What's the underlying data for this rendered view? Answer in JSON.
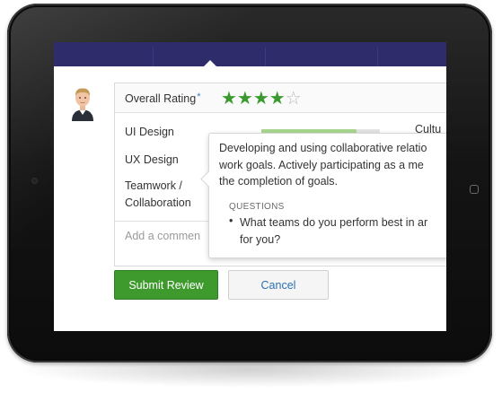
{
  "review": {
    "overall_label": "Overall Rating",
    "required_mark": "*",
    "rating_filled": "★★★★",
    "rating_empty": "☆",
    "rating_value": 4,
    "rating_max": 5
  },
  "skills": [
    {
      "name": "UI Design"
    },
    {
      "name": "UX Design"
    },
    {
      "name": "Teamwork /"
    },
    {
      "name": "Collaboration"
    }
  ],
  "culture_label": "Cultu",
  "comment_placeholder": "Add a commen",
  "tooltip": {
    "description_lines": [
      "Developing and using collaborative relatio",
      "work goals. Actively participating as a me",
      "the completion of goals."
    ],
    "questions_heading": "QUESTIONS",
    "bullet": "•",
    "question_lines": [
      "What teams do you perform best in ar",
      "for you?"
    ]
  },
  "actions": {
    "submit_label": "Submit Review",
    "cancel_label": "Cancel"
  },
  "colors": {
    "nav_bg": "#2e2c6a",
    "star_green": "#3a9a2e",
    "submit_green": "#3e9a2d",
    "link_blue": "#2e6fb5"
  },
  "icons": {
    "avatar": "user-avatar-photo",
    "home_button": "ipad-home-button"
  }
}
